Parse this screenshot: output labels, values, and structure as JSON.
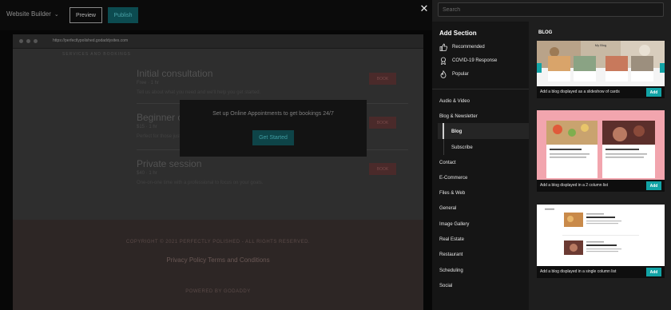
{
  "editor": {
    "brand": "Website Builder",
    "preview_label": "Preview",
    "publish_label": "Publish",
    "url_text": "https://perfectlypolished.godaddysites.com",
    "services_heading": "SERVICES AND BOOKINGS",
    "services": [
      {
        "name": "Initial consultation",
        "sub": "Free · 1 hr",
        "desc": "Tell us about what you need and we'll help you get started.",
        "book": "BOOK"
      },
      {
        "name": "Beginner class",
        "sub": "$15 · 1 hr",
        "desc": "Perfect for those just getting started with polishing.",
        "book": "BOOK"
      },
      {
        "name": "Private session",
        "sub": "$40 · 1 hr",
        "desc": "One-on-one time with a professional to focus on your goals.",
        "book": "BOOK"
      }
    ],
    "overlay_message": "Set up Online Appointments to get bookings 24/7",
    "overlay_button": "Get Started",
    "footer_copyright": "COPYRIGHT © 2021 PERFECTLY POLISHED - ALL RIGHTS RESERVED.",
    "footer_links": "Privacy Policy   Terms and Conditions",
    "footer_powered": "POWERED BY GODADDY"
  },
  "panel": {
    "search_placeholder": "Search",
    "categories_title": "Add Section",
    "recommended": [
      {
        "label": "Recommended",
        "icon": "thumbs-up-icon"
      },
      {
        "label": "COVID-19 Response",
        "icon": "award-ribbon-icon"
      },
      {
        "label": "Popular",
        "icon": "flame-icon"
      }
    ],
    "categories": [
      "Audio & Video",
      "Blog & Newsletter",
      "Contact",
      "E-Commerce",
      "Files & Web",
      "General",
      "Image Gallery",
      "Real Estate",
      "Restaurant",
      "Scheduling",
      "Social"
    ],
    "subcategories": [
      "Blog",
      "Subscribe"
    ],
    "active_subcategory": "Blog",
    "results_title": "BLOG",
    "cards": [
      {
        "caption": "Add a blog displayed as a slideshow of cards",
        "add_label": "Add",
        "thumb_title": "My Blog"
      },
      {
        "caption": "Add a blog displayed in a 2 column list",
        "add_label": "Add",
        "thumb_title": ""
      },
      {
        "caption": "Add a blog displayed in a single column list",
        "add_label": "Add",
        "thumb_title": ""
      }
    ],
    "accent": "#12a3a5"
  }
}
